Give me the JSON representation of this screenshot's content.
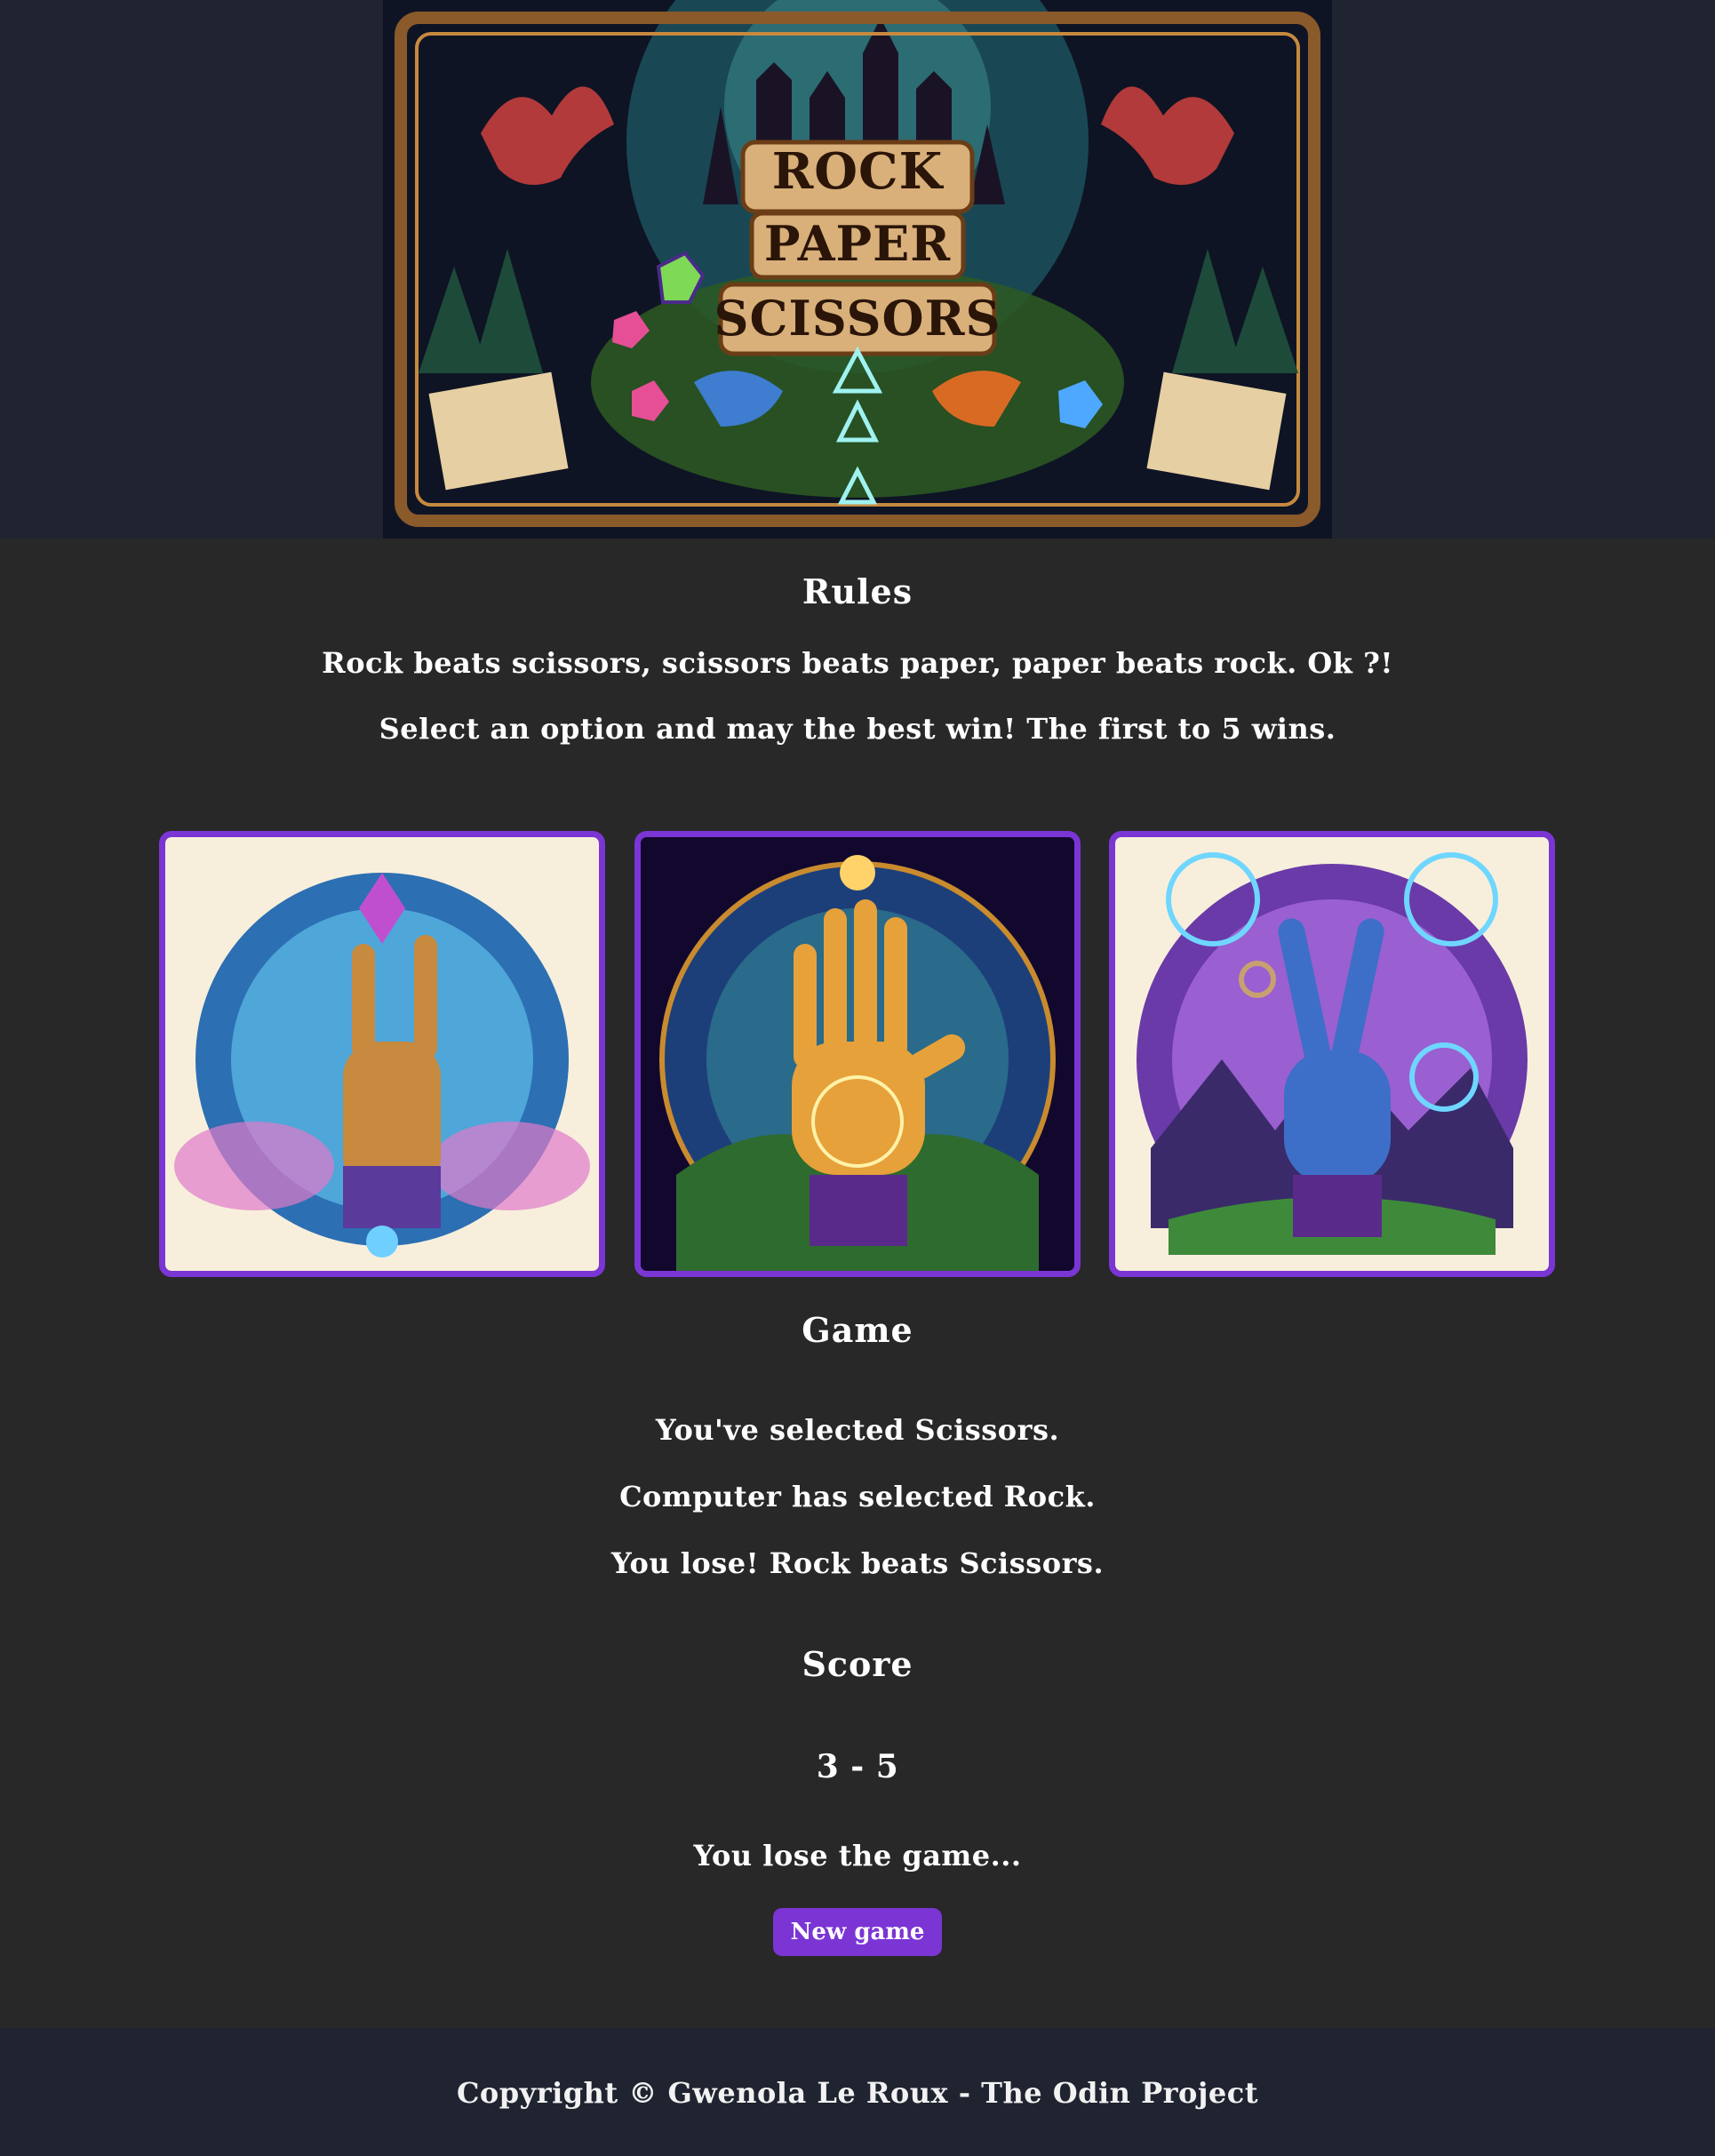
{
  "hero": {
    "banner_words": [
      "ROCK",
      "PAPER",
      "SCISSORS"
    ]
  },
  "rules": {
    "title": "Rules",
    "line1": "Rock beats scissors, scissors beats paper, paper beats rock. Ok ?!",
    "line2": "Select an option and may the best win! The first to 5 wins."
  },
  "choices": [
    {
      "name": "rock",
      "icon": "rock-hand-icon"
    },
    {
      "name": "paper",
      "icon": "paper-hand-icon"
    },
    {
      "name": "scissors",
      "icon": "scissors-hand-icon"
    }
  ],
  "game": {
    "title": "Game",
    "player_choice": "You've selected Scissors.",
    "computer_choice": "Computer has selected Rock.",
    "round_result": "You lose! Rock beats Scissors."
  },
  "score": {
    "title": "Score",
    "value": "3 - 5",
    "final_message": "You lose the game...",
    "new_game_label": "New game"
  },
  "footer": {
    "text": "Copyright © Gwenola Le Roux - The Odin Project"
  },
  "colors": {
    "accent": "#7b35d4",
    "background": "#282828",
    "band": "#1f2430"
  }
}
